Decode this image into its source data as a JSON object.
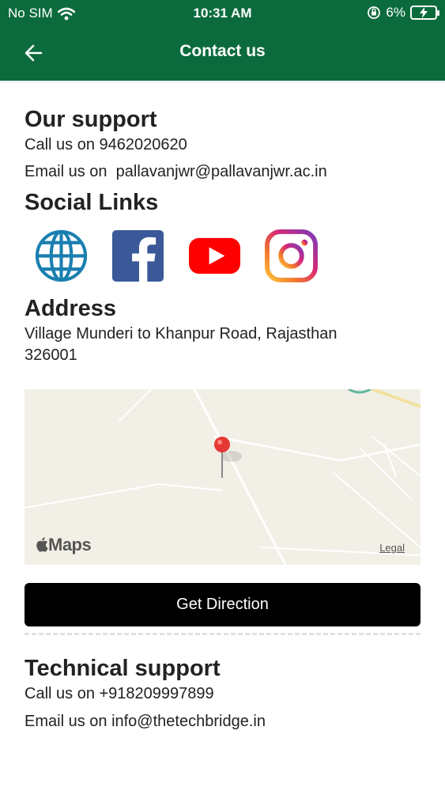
{
  "status_bar": {
    "carrier": "No SIM",
    "time": "10:31 AM",
    "battery": "6%"
  },
  "header": {
    "title": "Contact us"
  },
  "our_support": {
    "heading": "Our support",
    "call_prefix": "Call us on",
    "phone": "9462020620",
    "email_prefix": "Email us on",
    "email": "pallavanjwr@pallavanjwr.ac.in"
  },
  "social": {
    "heading": "Social Links",
    "items": [
      {
        "name": "website",
        "icon": "globe-icon"
      },
      {
        "name": "facebook",
        "icon": "facebook-icon"
      },
      {
        "name": "youtube",
        "icon": "youtube-icon"
      },
      {
        "name": "instagram",
        "icon": "instagram-icon"
      }
    ]
  },
  "address": {
    "heading": "Address",
    "line1": "Village Munderi to Khanpur Road, Rajasthan",
    "line2": "326001"
  },
  "map": {
    "logo": "Maps",
    "legal": "Legal"
  },
  "get_direction": "Get Direction",
  "technical_support": {
    "heading": "Technical support",
    "call_prefix": "Call us on",
    "phone": "+918209997899",
    "email_prefix": "Email us on",
    "email": "info@thetechbridge.in"
  },
  "colors": {
    "header": "#0c6b3d",
    "button": "#000000",
    "text": "#222222"
  }
}
